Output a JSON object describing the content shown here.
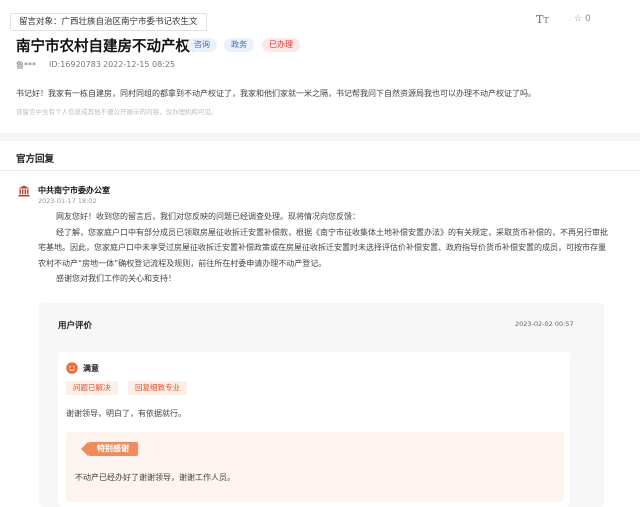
{
  "header": {
    "target_label": "留言对象：广西壮族自治区南宁市委书记农生文",
    "font_size_icon": "font-size-icon",
    "favorite_count": "0"
  },
  "message": {
    "title": "南宁市农村自建房不动产权证",
    "badges": [
      "咨询",
      "政务",
      "已办理"
    ],
    "author": "鲁***",
    "id": "ID:16920783",
    "date": "2022-12-15 08:25",
    "content": "书记好！我家有一栋自建房，同村同组的都拿到不动产权证了，我家和他们家就一米之隔，书记帮我问下自然资源局我也可以办理不动产权证了吗。",
    "notice": "该留言中含有个人信息或其他不便公开展示的内容，仅办理机构可见。"
  },
  "reply": {
    "section_title": "官方回复",
    "org_name": "中共南宁市委办公室",
    "org_time": "2023-01-17 18:02",
    "paragraphs": [
      "网友您好！收到您的留言后，我们对您反映的问题已经调查处理。现将情况向您反馈：",
      "经了解，您家庭户口中有部分成员已领取房屋征收拆迁安置补偿款，根据《南宁市征收集体土地补偿安置办法》的有关规定，采取货币补偿的，不再另行审批宅基地。因此，您家庭户口中未享受过房屋征收拆迁安置补偿政策或在房屋征收拆迁安置时未选择评估价补偿安置、政府指导价货币补偿安置的成员，可按市存量农村不动产“房地一体”确权登记流程及规则，前往所在村委申请办理不动产登记。",
      "感谢您对我们工作的关心和支持！"
    ]
  },
  "evaluation": {
    "title": "用户评价",
    "time": "2023-02-02 00:57",
    "rating": "满意",
    "tags": [
      "问题已解决",
      "回复细致专业"
    ],
    "comment": "谢谢领导，明白了，有依据就行。",
    "thanks_label": "特别感谢",
    "thanks_text": "不动产已经办好了谢谢领导，谢谢工作人员。"
  },
  "colors": {
    "accent_red": "#d33333",
    "accent_blue": "#3d6fb6",
    "tag_orange": "#d9562f",
    "thanks_orange": "#f08c5c"
  }
}
